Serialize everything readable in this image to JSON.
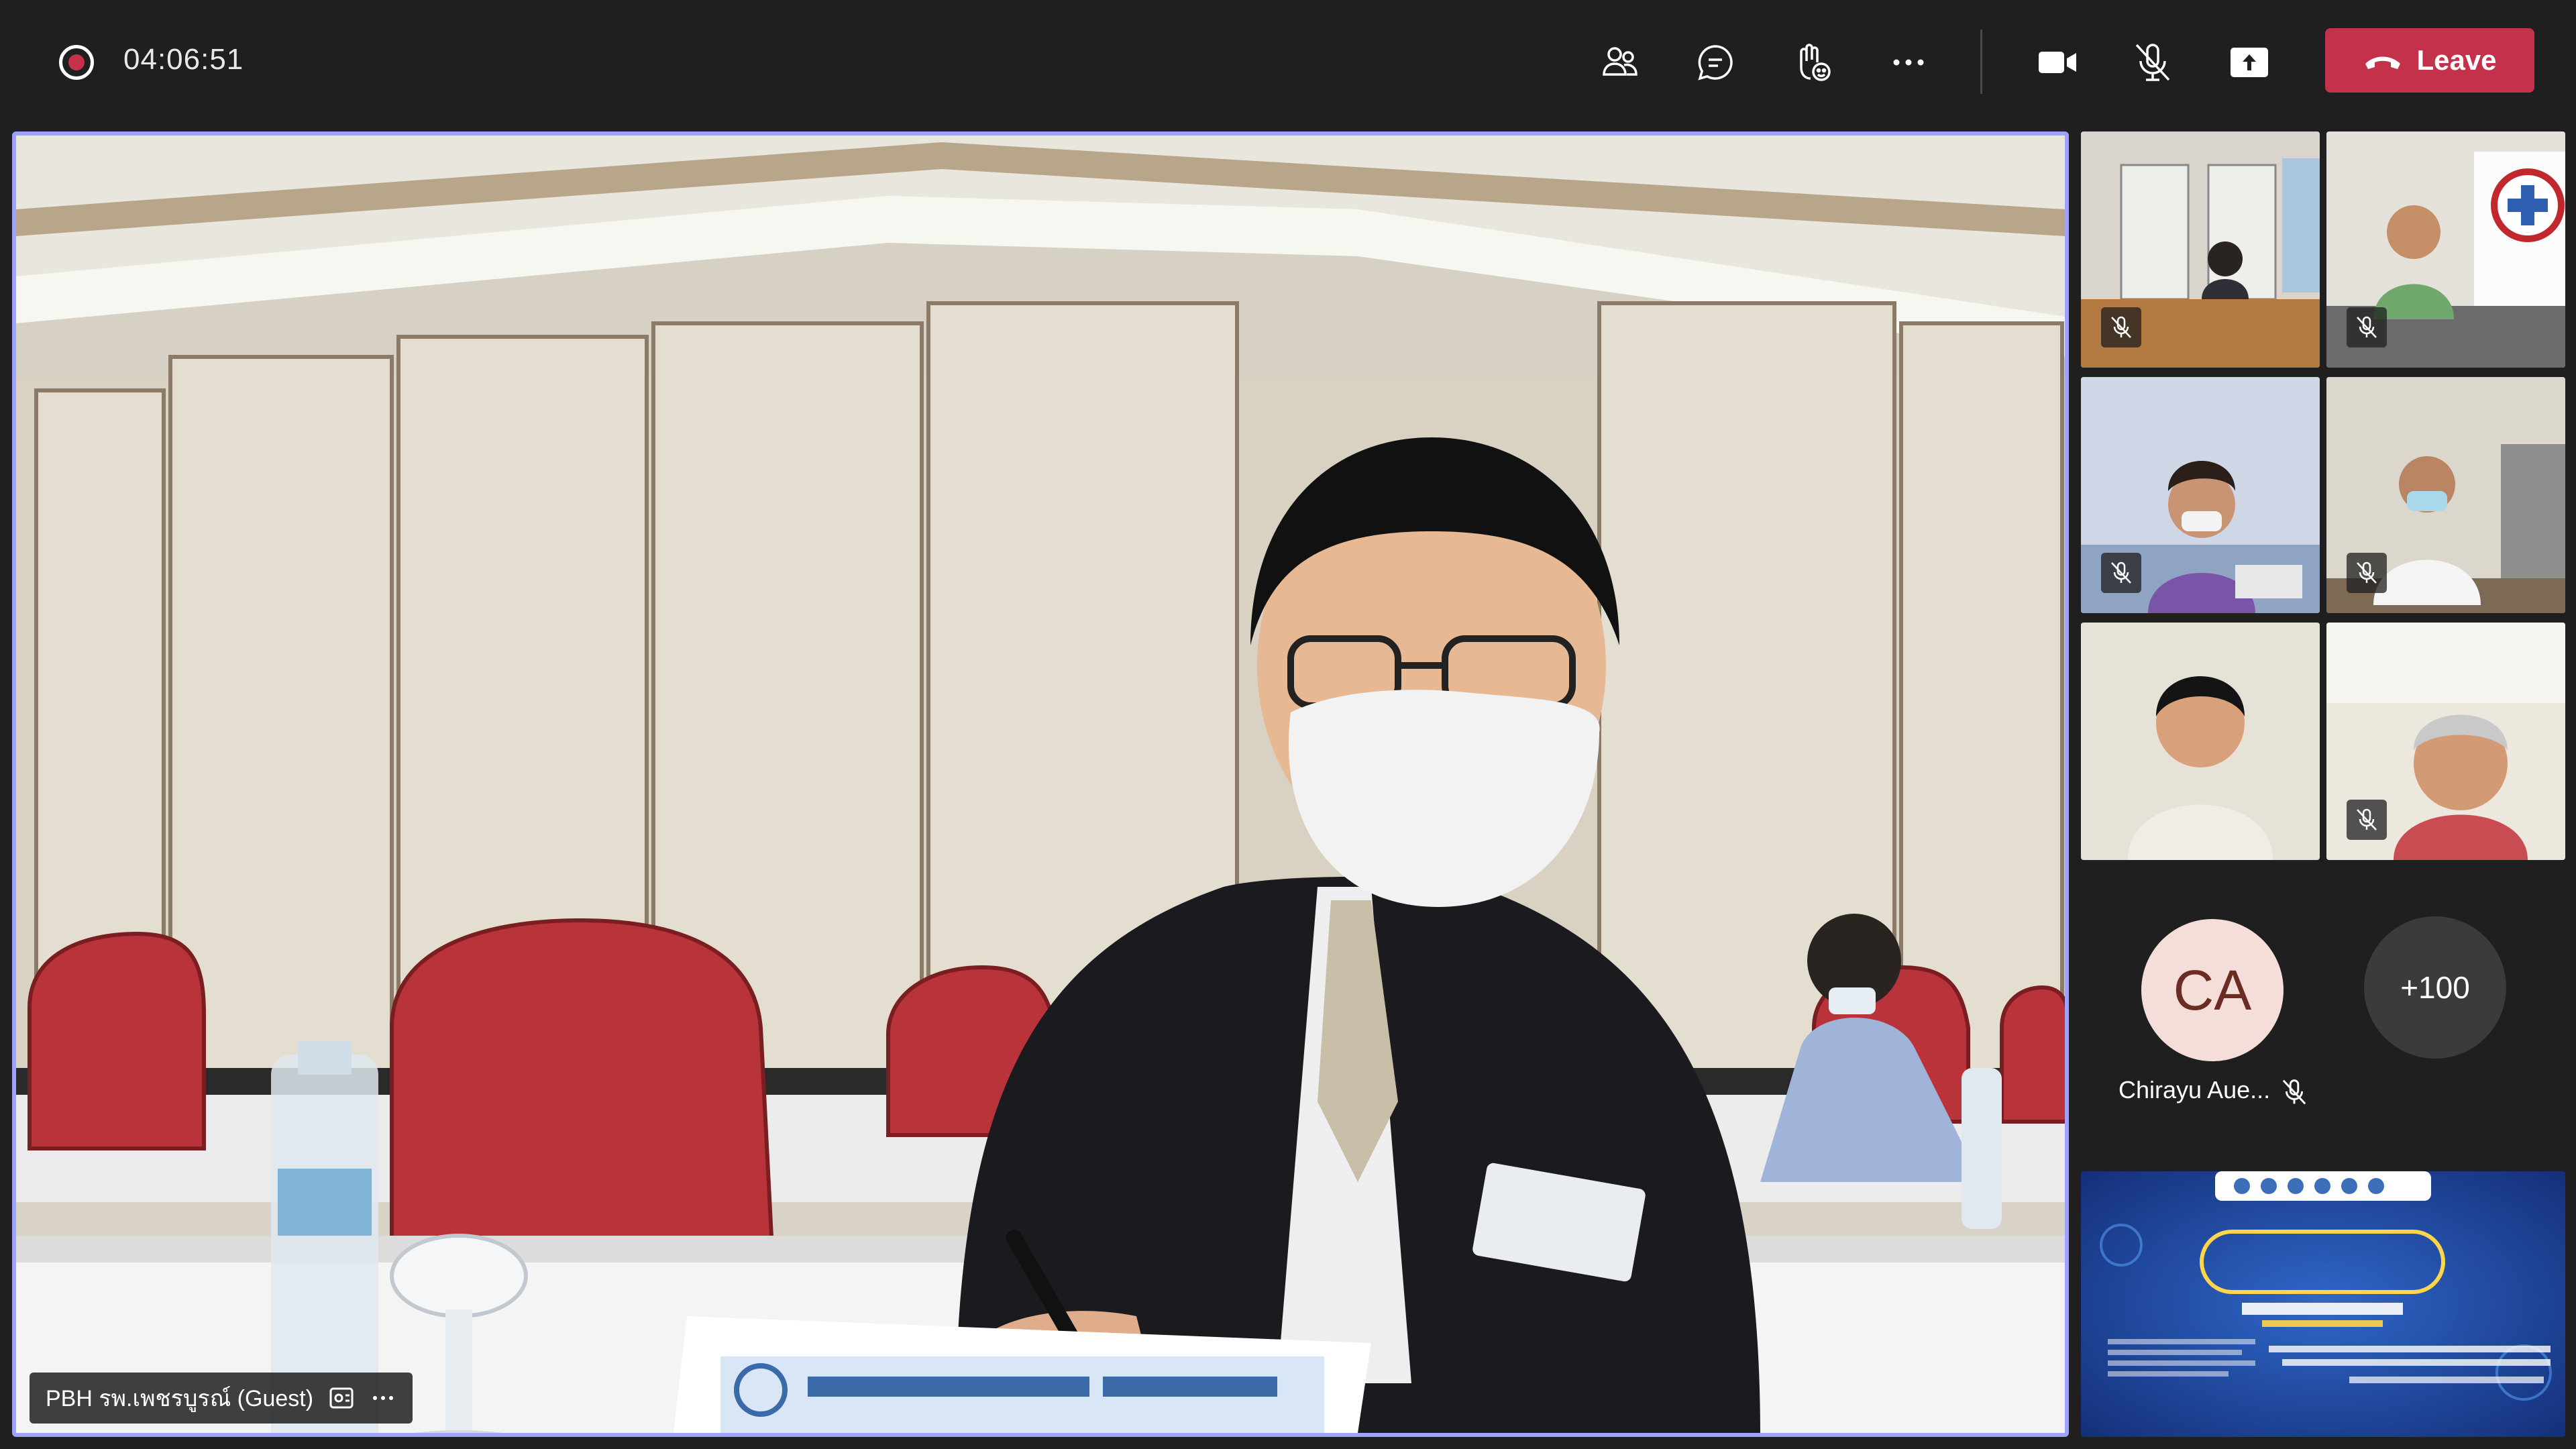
{
  "meeting": {
    "elapsed_time": "04:06:51"
  },
  "toolbar": {
    "leave_label": "Leave",
    "buttons": [
      "people-icon",
      "chat-icon",
      "reactions-icon",
      "more-icon",
      "camera-icon",
      "mic-off-icon",
      "share-icon"
    ]
  },
  "main_stage": {
    "participant_label": "PBH รพ.เพชรบูรณ์ (Guest)"
  },
  "gallery": {
    "avatar_initials": "CA",
    "avatar_name": "Chirayu Aue...",
    "overflow_count": "+100"
  },
  "colors": {
    "accent_border": "#9ea2ff",
    "leave_red": "#c4314b",
    "background": "#1f1f1f"
  }
}
